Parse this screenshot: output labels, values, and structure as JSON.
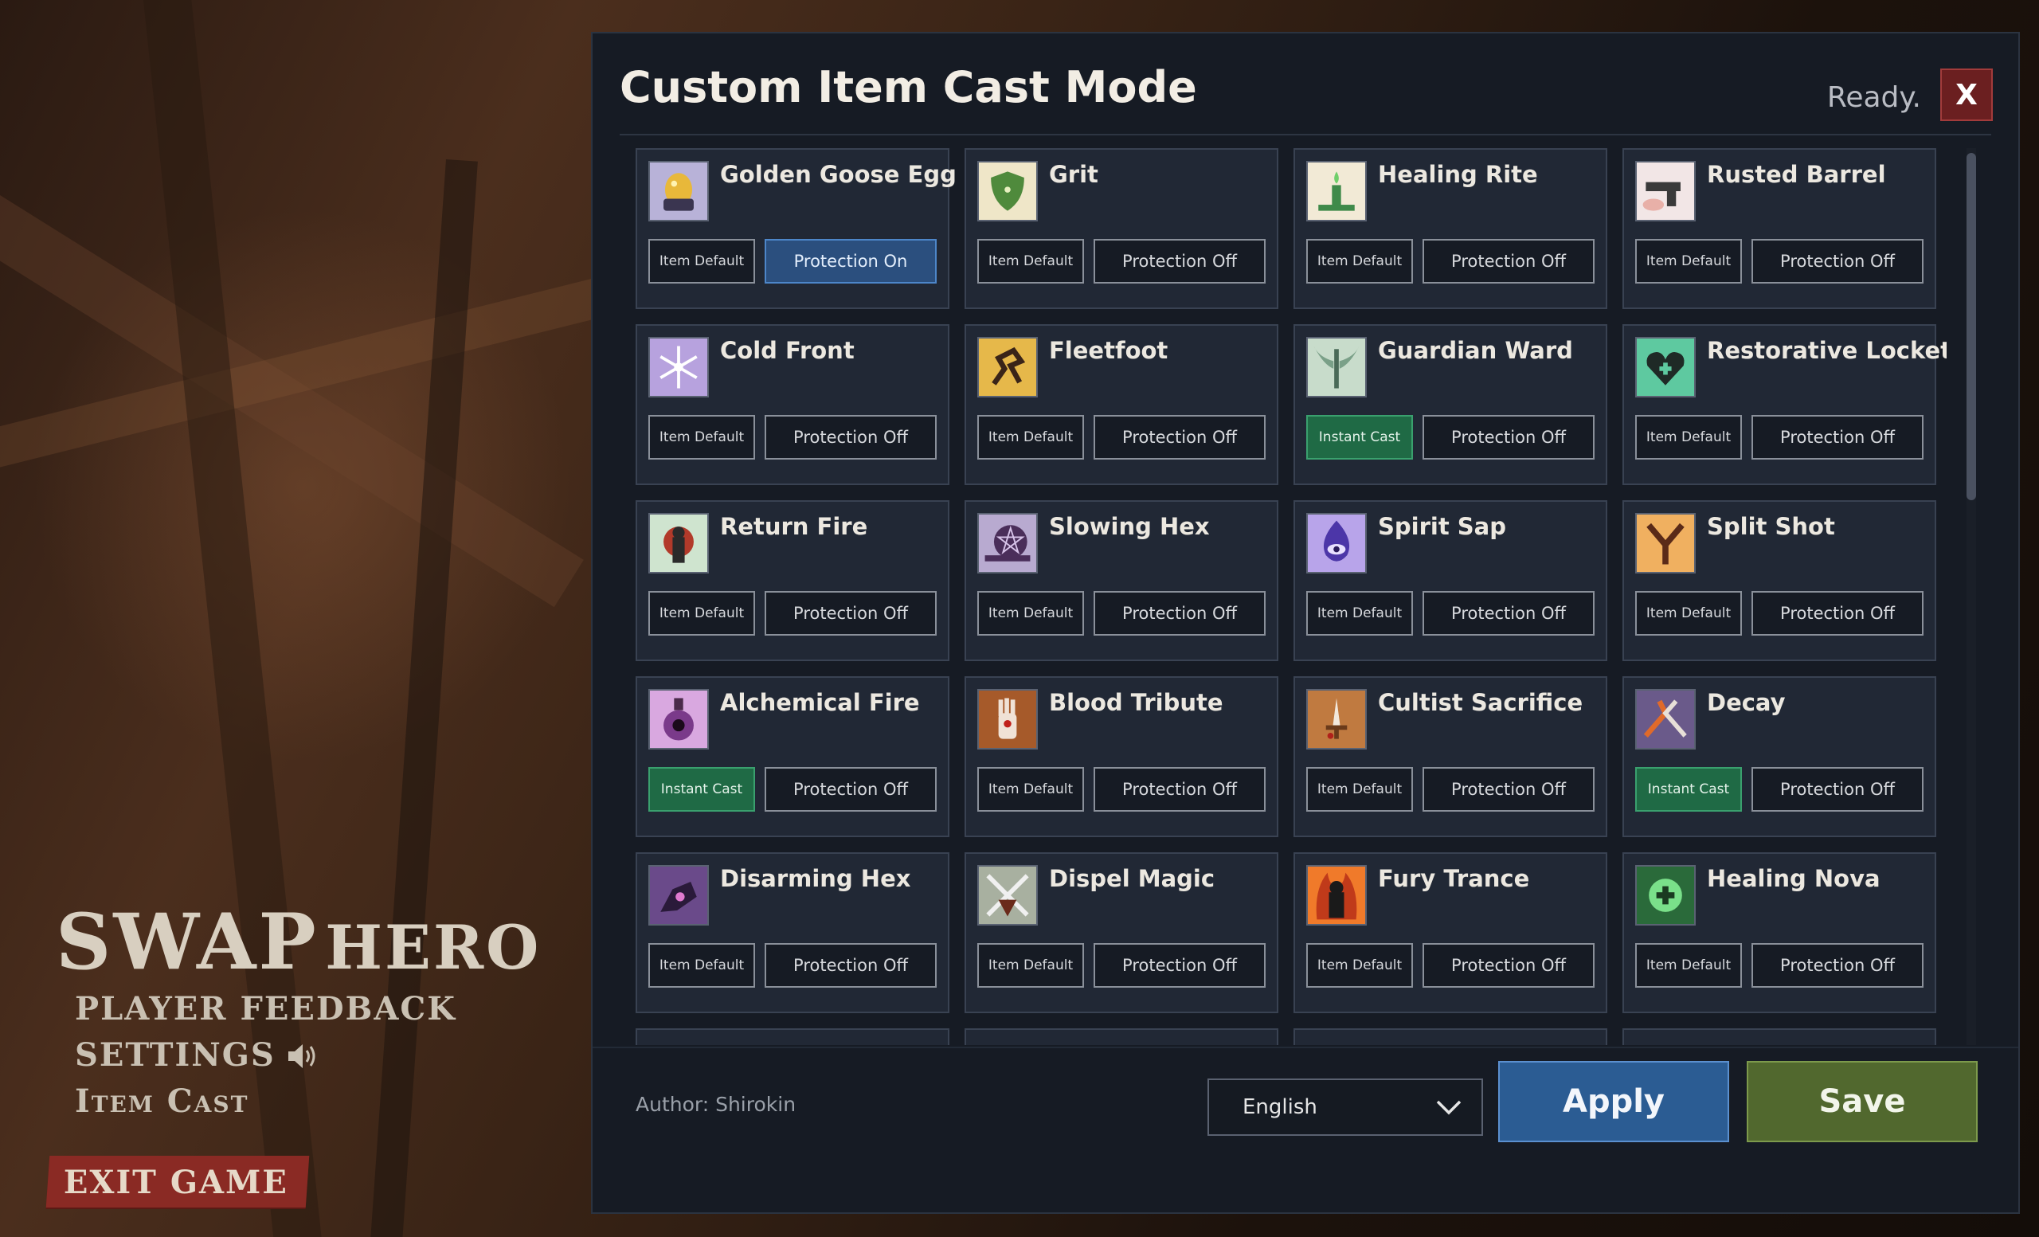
{
  "menu": {
    "title_main": "SWAP",
    "title_sub": "HERO",
    "items": [
      {
        "label": "PLAYER FEEDBACK"
      },
      {
        "label": "SETTINGS"
      },
      {
        "label": "Item Cast"
      }
    ],
    "exit_label": "EXIT GAME"
  },
  "dialog": {
    "title": "Custom Item Cast Mode",
    "status": "Ready.",
    "close_label": "X",
    "author": "Author: Shirokin",
    "language": "English",
    "apply_label": "Apply",
    "save_label": "Save"
  },
  "colors": {
    "instant_cast": "#1f6a45",
    "protection_on": "#2b4f7e",
    "apply": "#2b5c93",
    "save": "#51682e",
    "close": "#6b1f20"
  },
  "items": [
    {
      "name": "Golden Goose Egg",
      "cast": "Item Default",
      "protection": "Protection On",
      "icon": "golden-egg-icon"
    },
    {
      "name": "Grit",
      "cast": "Item Default",
      "protection": "Protection Off",
      "icon": "shield-icon"
    },
    {
      "name": "Healing Rite",
      "cast": "Item Default",
      "protection": "Protection Off",
      "icon": "candle-icon"
    },
    {
      "name": "Rusted Barrel",
      "cast": "Item Default",
      "protection": "Protection Off",
      "icon": "pistol-icon"
    },
    {
      "name": "Cold Front",
      "cast": "Item Default",
      "protection": "Protection Off",
      "icon": "snowflake-icon"
    },
    {
      "name": "Fleetfoot",
      "cast": "Item Default",
      "protection": "Protection Off",
      "icon": "running-figure-icon"
    },
    {
      "name": "Guardian Ward",
      "cast": "Instant Cast",
      "protection": "Protection Off",
      "icon": "winged-sword-icon"
    },
    {
      "name": "Restorative Locket",
      "cast": "Item Default",
      "protection": "Protection Off",
      "icon": "heart-locket-icon"
    },
    {
      "name": "Return Fire",
      "cast": "Item Default",
      "protection": "Protection Off",
      "icon": "burst-figure-icon"
    },
    {
      "name": "Slowing Hex",
      "cast": "Item Default",
      "protection": "Protection Off",
      "icon": "snail-pentagram-icon"
    },
    {
      "name": "Spirit Sap",
      "cast": "Item Default",
      "protection": "Protection Off",
      "icon": "eye-flame-icon"
    },
    {
      "name": "Split Shot",
      "cast": "Item Default",
      "protection": "Protection Off",
      "icon": "split-arrows-icon"
    },
    {
      "name": "Alchemical Fire",
      "cast": "Instant Cast",
      "protection": "Protection Off",
      "icon": "potion-icon"
    },
    {
      "name": "Blood Tribute",
      "cast": "Item Default",
      "protection": "Protection Off",
      "icon": "bleeding-hand-icon"
    },
    {
      "name": "Cultist Sacrifice",
      "cast": "Item Default",
      "protection": "Protection Off",
      "icon": "dagger-icon"
    },
    {
      "name": "Decay",
      "cast": "Instant Cast",
      "protection": "Protection Off",
      "icon": "decay-hands-icon"
    },
    {
      "name": "Disarming Hex",
      "cast": "Item Default",
      "protection": "Protection Off",
      "icon": "hex-hand-icon"
    },
    {
      "name": "Dispel Magic",
      "cast": "Item Default",
      "protection": "Protection Off",
      "icon": "crossed-swords-icon"
    },
    {
      "name": "Fury Trance",
      "cast": "Item Default",
      "protection": "Protection Off",
      "icon": "flaming-figure-icon"
    },
    {
      "name": "Healing Nova",
      "cast": "Item Default",
      "protection": "Protection Off",
      "icon": "nova-burst-icon"
    }
  ]
}
